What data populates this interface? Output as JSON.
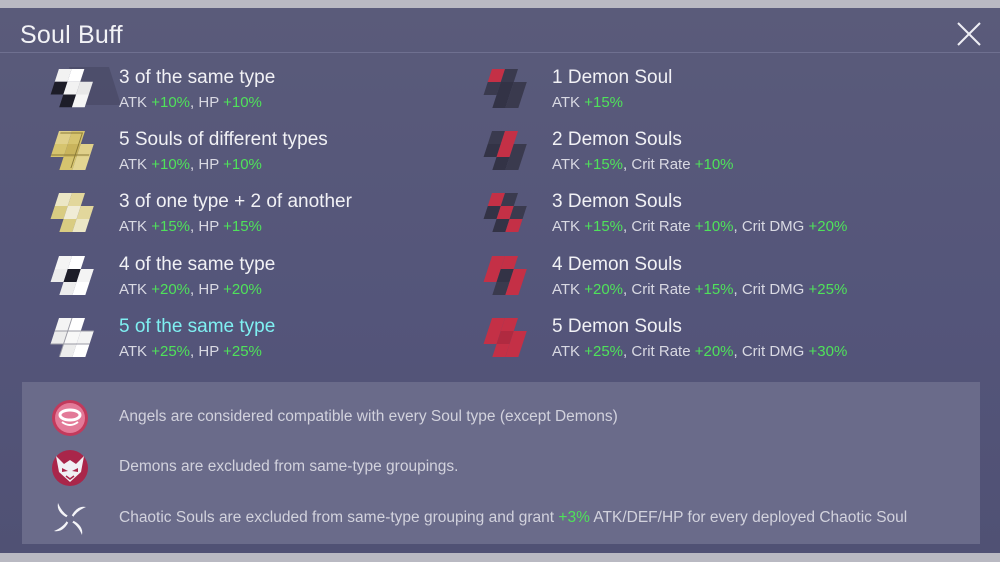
{
  "header": {
    "title": "Soul Buff"
  },
  "close": {
    "icon": "close-icon"
  },
  "colors": {
    "bonus": "#4fe25a",
    "highlight": "#7ff0f2",
    "demon_red": "#c43046",
    "gold": "#d6c46e"
  },
  "buffs_left": [
    {
      "name": "3 of the same type",
      "s": [
        "ATK ",
        "+10%",
        ", HP ",
        "+10%"
      ]
    },
    {
      "name": "5 Souls of different types",
      "s": [
        "ATK ",
        "+10%",
        ", HP ",
        "+10%"
      ]
    },
    {
      "name": "3 of one type + 2 of another",
      "s": [
        "ATK ",
        "+15%",
        ", HP ",
        "+15%"
      ]
    },
    {
      "name": "4 of the same type",
      "s": [
        "ATK ",
        "+20%",
        ", HP ",
        "+20%"
      ]
    },
    {
      "name": "5 of the same type",
      "s": [
        "ATK ",
        "+25%",
        ", HP ",
        "+25%"
      ]
    }
  ],
  "buffs_right": [
    {
      "name": "1 Demon Soul",
      "s": [
        "ATK ",
        "+15%"
      ]
    },
    {
      "name": "2 Demon Souls",
      "s": [
        "ATK ",
        "+15%",
        ", Crit Rate ",
        "+10%"
      ]
    },
    {
      "name": "3 Demon Souls",
      "s": [
        "ATK ",
        "+15%",
        ", Crit Rate ",
        "+10%",
        ", Crit DMG ",
        "+20%"
      ]
    },
    {
      "name": "4 Demon Souls",
      "s": [
        "ATK ",
        "+20%",
        ", Crit Rate ",
        "+15%",
        ", Crit DMG ",
        "+25%"
      ]
    },
    {
      "name": "5 Demon Souls",
      "s": [
        "ATK ",
        "+25%",
        ", Crit Rate ",
        "+20%",
        ", Crit DMG ",
        "+30%"
      ]
    }
  ],
  "notes": [
    {
      "icon": "angel-halo-icon",
      "text": "Angels are considered compatible with every Soul type (except Demons)"
    },
    {
      "icon": "demon-mask-icon",
      "text": "Demons are excluded from same-type groupings."
    },
    {
      "icon": "chaotic-swirl-icon",
      "pre": "Chaotic Souls are excluded from same-type grouping and grant ",
      "bonus": "+3%",
      "post": " ATK/DEF/HP for every deployed Chaotic Soul"
    }
  ]
}
